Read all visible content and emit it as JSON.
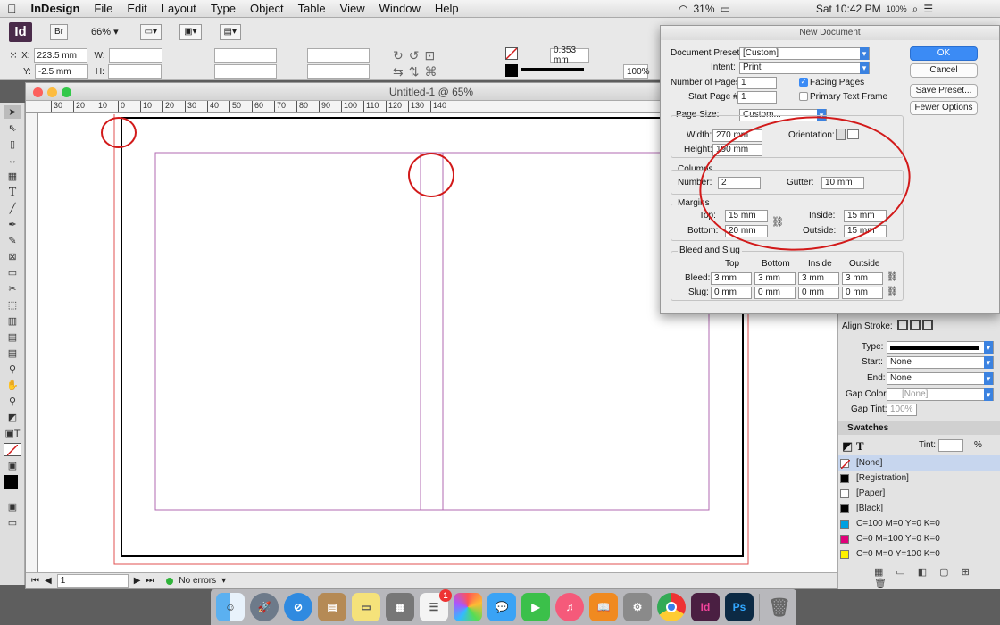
{
  "menubar": {
    "apple": "",
    "app": "InDesign",
    "items": [
      "File",
      "Edit",
      "Layout",
      "Type",
      "Object",
      "Table",
      "View",
      "Window",
      "Help"
    ],
    "clock": "Sat 10:42 PM",
    "battery": "31%",
    "zoom_small": "100%"
  },
  "control": {
    "logo": "Id",
    "br": "Br",
    "zoom": "66%",
    "x_label": "X:",
    "x_value": "223.5 mm",
    "y_label": "Y:",
    "y_value": "-2.5 mm",
    "w_label": "W:",
    "h_label": "H:",
    "stroke": "0.353 mm",
    "opacity": "100%"
  },
  "document": {
    "title": "Untitled-1 @ 65%",
    "ruler_ticks": [
      "30",
      "20",
      "10",
      "0",
      "10",
      "20",
      "30",
      "40",
      "50",
      "60",
      "70",
      "80",
      "90",
      "100",
      "110",
      "120",
      "130",
      "140"
    ],
    "page": "1",
    "errors": "No errors"
  },
  "dialog": {
    "title": "New Document",
    "preset_label": "Document Preset:",
    "preset_value": "[Custom]",
    "intent_label": "Intent:",
    "intent_value": "Print",
    "pages_label": "Number of Pages:",
    "pages_value": "1",
    "start_label": "Start Page #:",
    "start_value": "1",
    "facing_label": "Facing Pages",
    "primary_label": "Primary Text Frame",
    "pagesize_label": "Page Size:",
    "pagesize_value": "Custom...",
    "width_label": "Width:",
    "width_value": "270 mm",
    "height_label": "Height:",
    "height_value": "190 mm",
    "orientation_label": "Orientation:",
    "columns_label": "Columns",
    "number_label": "Number:",
    "number_value": "2",
    "gutter_label": "Gutter:",
    "gutter_value": "10 mm",
    "margins_label": "Margins",
    "top_label": "Top:",
    "top_value": "15 mm",
    "bottom_label": "Bottom:",
    "bottom_value": "20 mm",
    "inside_label": "Inside:",
    "inside_value": "15 mm",
    "outside_label": "Outside:",
    "outside_value": "15 mm",
    "bleed_slug_label": "Bleed and Slug",
    "col_top": "Top",
    "col_bottom": "Bottom",
    "col_inside": "Inside",
    "col_outside": "Outside",
    "bleed_label": "Bleed:",
    "bleed_values": [
      "3 mm",
      "3 mm",
      "3 mm",
      "3 mm"
    ],
    "slug_label": "Slug:",
    "slug_values": [
      "0 mm",
      "0 mm",
      "0 mm",
      "0 mm"
    ],
    "ok": "OK",
    "cancel": "Cancel",
    "save_preset": "Save Preset...",
    "fewer_options": "Fewer Options"
  },
  "stroke_panel": {
    "align_label": "Align Stroke:",
    "type_label": "Type:",
    "start_label": "Start:",
    "start_value": "None",
    "end_label": "End:",
    "end_value": "None",
    "gapcolor_label": "Gap Color:",
    "gapcolor_value": "[None]",
    "gaptint_label": "Gap Tint:",
    "gaptint_value": "100%"
  },
  "swatches": {
    "title": "Swatches",
    "tint_label": "Tint:",
    "tint_unit": "%",
    "items": [
      {
        "name": "[None]",
        "color": "#ffffff"
      },
      {
        "name": "[Registration]",
        "color": "#000000"
      },
      {
        "name": "[Paper]",
        "color": "#ffffff"
      },
      {
        "name": "[Black]",
        "color": "#000000"
      },
      {
        "name": "C=100 M=0 Y=0 K=0",
        "color": "#00a0e0"
      },
      {
        "name": "C=0 M=100 Y=0 K=0",
        "color": "#e0007a"
      },
      {
        "name": "C=0 M=0 Y=100 K=0",
        "color": "#fff200"
      }
    ]
  },
  "dock": {
    "items": [
      "finder",
      "launchpad",
      "safari",
      "notes",
      "stickies",
      "calculator",
      "reminders",
      "photos",
      "messages",
      "facetime",
      "itunes",
      "ibooks",
      "preferences",
      "chrome",
      "indesign",
      "photoshop",
      "trash"
    ],
    "id_label": "Id",
    "ps_label": "Ps",
    "badge": "1"
  },
  "colors": {
    "annotation_red": "#d21a1a",
    "margin_purple": "#b06ab0",
    "bleed_red": "#e05050",
    "accent_blue": "#3b8bf5"
  }
}
